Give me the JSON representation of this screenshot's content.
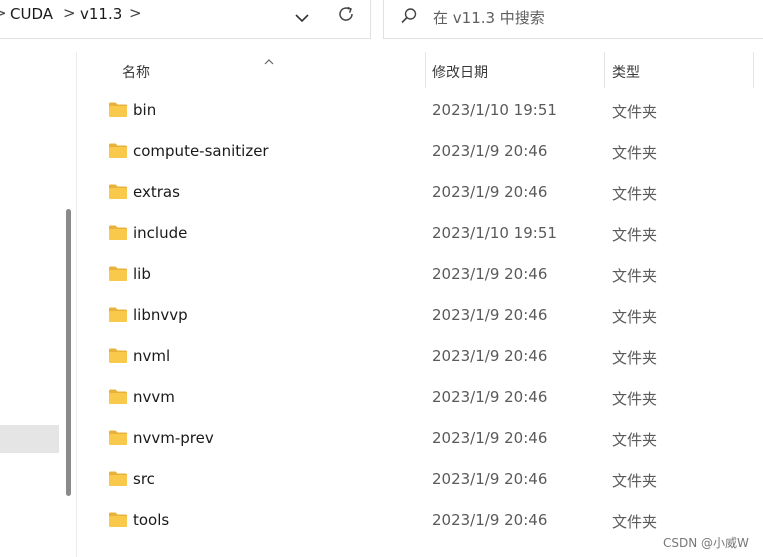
{
  "address_bar": {
    "crumbs": [
      "CUDA",
      "v11.3"
    ],
    "separator": ">",
    "dropdown_icon": "chevron-down-icon",
    "refresh_icon": "refresh-icon"
  },
  "search": {
    "placeholder": "在 v11.3 中搜索",
    "icon": "search-icon"
  },
  "columns": {
    "name": "名称",
    "date_modified": "修改日期",
    "type": "类型"
  },
  "files": [
    {
      "name": "bin",
      "date": "2023/1/10 19:51",
      "type": "文件夹"
    },
    {
      "name": "compute-sanitizer",
      "date": "2023/1/9 20:46",
      "type": "文件夹"
    },
    {
      "name": "extras",
      "date": "2023/1/9 20:46",
      "type": "文件夹"
    },
    {
      "name": "include",
      "date": "2023/1/10 19:51",
      "type": "文件夹"
    },
    {
      "name": "lib",
      "date": "2023/1/9 20:46",
      "type": "文件夹"
    },
    {
      "name": "libnvvp",
      "date": "2023/1/9 20:46",
      "type": "文件夹"
    },
    {
      "name": "nvml",
      "date": "2023/1/9 20:46",
      "type": "文件夹"
    },
    {
      "name": "nvvm",
      "date": "2023/1/9 20:46",
      "type": "文件夹"
    },
    {
      "name": "nvvm-prev",
      "date": "2023/1/9 20:46",
      "type": "文件夹"
    },
    {
      "name": "src",
      "date": "2023/1/9 20:46",
      "type": "文件夹"
    },
    {
      "name": "tools",
      "date": "2023/1/9 20:46",
      "type": "文件夹"
    }
  ],
  "watermark": "CSDN @小威W",
  "colors": {
    "folder": "#f8c94a",
    "folder_dark": "#e8b23a",
    "selection": "#e5e5e5",
    "scrollbar": "#8a8a8a"
  }
}
